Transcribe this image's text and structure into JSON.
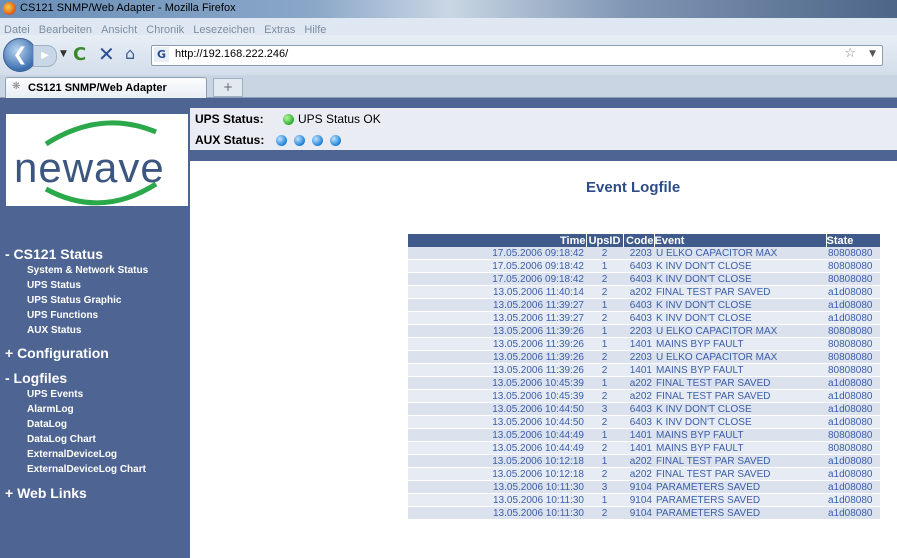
{
  "window": {
    "title": "CS121 SNMP/Web Adapter - Mozilla Firefox"
  },
  "menu": [
    "Datei",
    "Bearbeiten",
    "Ansicht",
    "Chronik",
    "Lesezeichen",
    "Extras",
    "Hilfe"
  ],
  "nav": {
    "url": "http://192.168.222.246/"
  },
  "tab": {
    "title": "CS121 SNMP/Web Adapter",
    "new_tab": "+"
  },
  "logo": {
    "text": "newave"
  },
  "sidebar": {
    "cs121_status": "- CS121 Status",
    "status_items": [
      "System & Network Status",
      "UPS Status",
      "UPS Status Graphic",
      "UPS Functions",
      "AUX Status"
    ],
    "configuration": "+ Configuration",
    "logfiles": "- Logfiles",
    "log_items": [
      "UPS Events",
      "AlarmLog",
      "DataLog",
      "DataLog Chart",
      "ExternalDeviceLog",
      "ExternalDeviceLog Chart"
    ],
    "web_links": "+ Web Links"
  },
  "status": {
    "ups_label": "UPS Status:",
    "ups_value": "UPS Status OK",
    "ups_color": "#2bb02b",
    "aux_label": "AUX Status:",
    "aux_color": "#1c7fd6"
  },
  "main": {
    "heading": "Event Logfile"
  },
  "table": {
    "headers": [
      "Time",
      "UpsID",
      "Code",
      "Event",
      "State"
    ],
    "rows": [
      [
        "17.05.2006 09:18:42",
        "2",
        "2203",
        "U ELKO CAPACITOR MAX",
        "80808080"
      ],
      [
        "17.05.2006 09:18:42",
        "1",
        "6403",
        "K INV DON'T CLOSE",
        "80808080"
      ],
      [
        "17.05.2006 09:18:42",
        "2",
        "6403",
        "K INV DON'T CLOSE",
        "80808080"
      ],
      [
        "13.05.2006 11:40:14",
        "2",
        "a202",
        "FINAL TEST PAR SAVED",
        "a1d08080"
      ],
      [
        "13.05.2006 11:39:27",
        "1",
        "6403",
        "K INV DON'T CLOSE",
        "a1d08080"
      ],
      [
        "13.05.2006 11:39:27",
        "2",
        "6403",
        "K INV DON'T CLOSE",
        "a1d08080"
      ],
      [
        "13.05.2006 11:39:26",
        "1",
        "2203",
        "U ELKO CAPACITOR MAX",
        "80808080"
      ],
      [
        "13.05.2006 11:39:26",
        "1",
        "1401",
        "MAINS BYP FAULT",
        "80808080"
      ],
      [
        "13.05.2006 11:39:26",
        "2",
        "2203",
        "U ELKO CAPACITOR MAX",
        "80808080"
      ],
      [
        "13.05.2006 11:39:26",
        "2",
        "1401",
        "MAINS BYP FAULT",
        "80808080"
      ],
      [
        "13.05.2006 10:45:39",
        "1",
        "a202",
        "FINAL TEST PAR SAVED",
        "a1d08080"
      ],
      [
        "13.05.2006 10:45:39",
        "2",
        "a202",
        "FINAL TEST PAR SAVED",
        "a1d08080"
      ],
      [
        "13.05.2006 10:44:50",
        "3",
        "6403",
        "K INV DON'T CLOSE",
        "a1d08080"
      ],
      [
        "13.05.2006 10:44:50",
        "2",
        "6403",
        "K INV DON'T CLOSE",
        "a1d08080"
      ],
      [
        "13.05.2006 10:44:49",
        "1",
        "1401",
        "MAINS BYP FAULT",
        "80808080"
      ],
      [
        "13.05.2006 10:44:49",
        "2",
        "1401",
        "MAINS BYP FAULT",
        "80808080"
      ],
      [
        "13.05.2006 10:12:18",
        "1",
        "a202",
        "FINAL TEST PAR SAVED",
        "a1d08080"
      ],
      [
        "13.05.2006 10:12:18",
        "2",
        "a202",
        "FINAL TEST PAR SAVED",
        "a1d08080"
      ],
      [
        "13.05.2006 10:11:30",
        "3",
        "9104",
        "PARAMETERS SAVED",
        "a1d08080"
      ],
      [
        "13.05.2006 10:11:30",
        "1",
        "9104",
        "PARAMETERS SAVED",
        "a1d08080"
      ],
      [
        "13.05.2006 10:11:30",
        "2",
        "9104",
        "PARAMETERS SAVED",
        "a1d08080"
      ]
    ]
  }
}
